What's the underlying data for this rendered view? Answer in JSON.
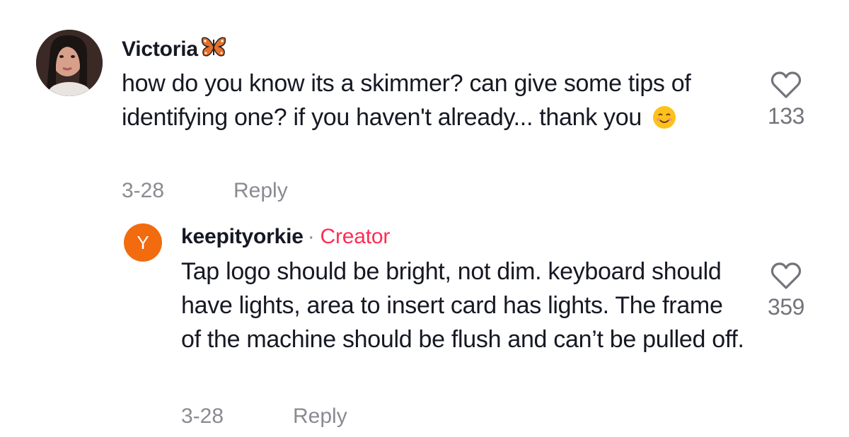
{
  "comment": {
    "username": "Victoria",
    "username_icon": "butterfly-emoji",
    "text": "how do you know its a skimmer? can give some tips of identifying one? if you haven't already... thank you",
    "text_emoji": "smiling-face-emoji",
    "date": "3-28",
    "reply_label": "Reply",
    "like_count": "133"
  },
  "reply": {
    "avatar_letter": "Y",
    "avatar_color": "#f26b0f",
    "username": "keepityorkie",
    "separator": "·",
    "badge": "Creator",
    "badge_color": "#fe2c55",
    "text": "Tap logo should be bright, not dim. keyboard should have lights, area to insert card has lights. The frame of the machine should be flush and can’t be pulled off.",
    "date": "3-28",
    "reply_label": "Reply",
    "like_count": "359"
  }
}
